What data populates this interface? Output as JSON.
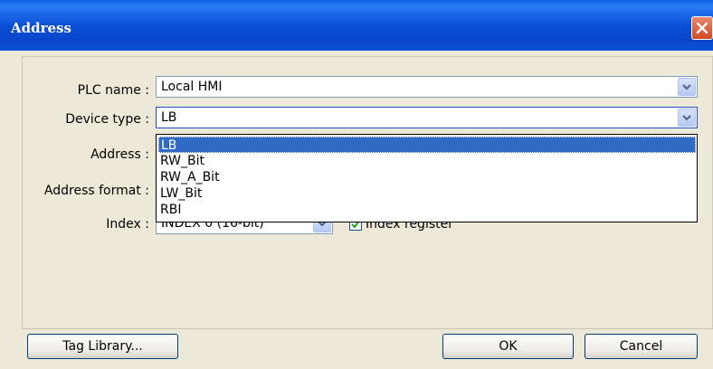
{
  "window": {
    "title": "Address"
  },
  "form": {
    "plc_name_label": "PLC name :",
    "plc_name_value": "Local HMI",
    "device_type_label": "Device type :",
    "device_type_value": "LB",
    "address_label": "Address :",
    "address_format_label": "Address format :",
    "index_label": "Index :",
    "index_value": "INDEX 0 (16-bit)",
    "index_register_label": "Index register",
    "index_register_checked": true
  },
  "dropdown": {
    "options": [
      "LB",
      "RW_Bit",
      "RW_A_Bit",
      "LW_Bit",
      "RBI"
    ],
    "selected": "LB"
  },
  "buttons": {
    "tag_library": "Tag Library...",
    "ok": "OK",
    "cancel": "Cancel"
  },
  "colors": {
    "titlebar": "#0a4fd8",
    "selection": "#316ac5",
    "dialog_bg": "#ece9d8"
  }
}
